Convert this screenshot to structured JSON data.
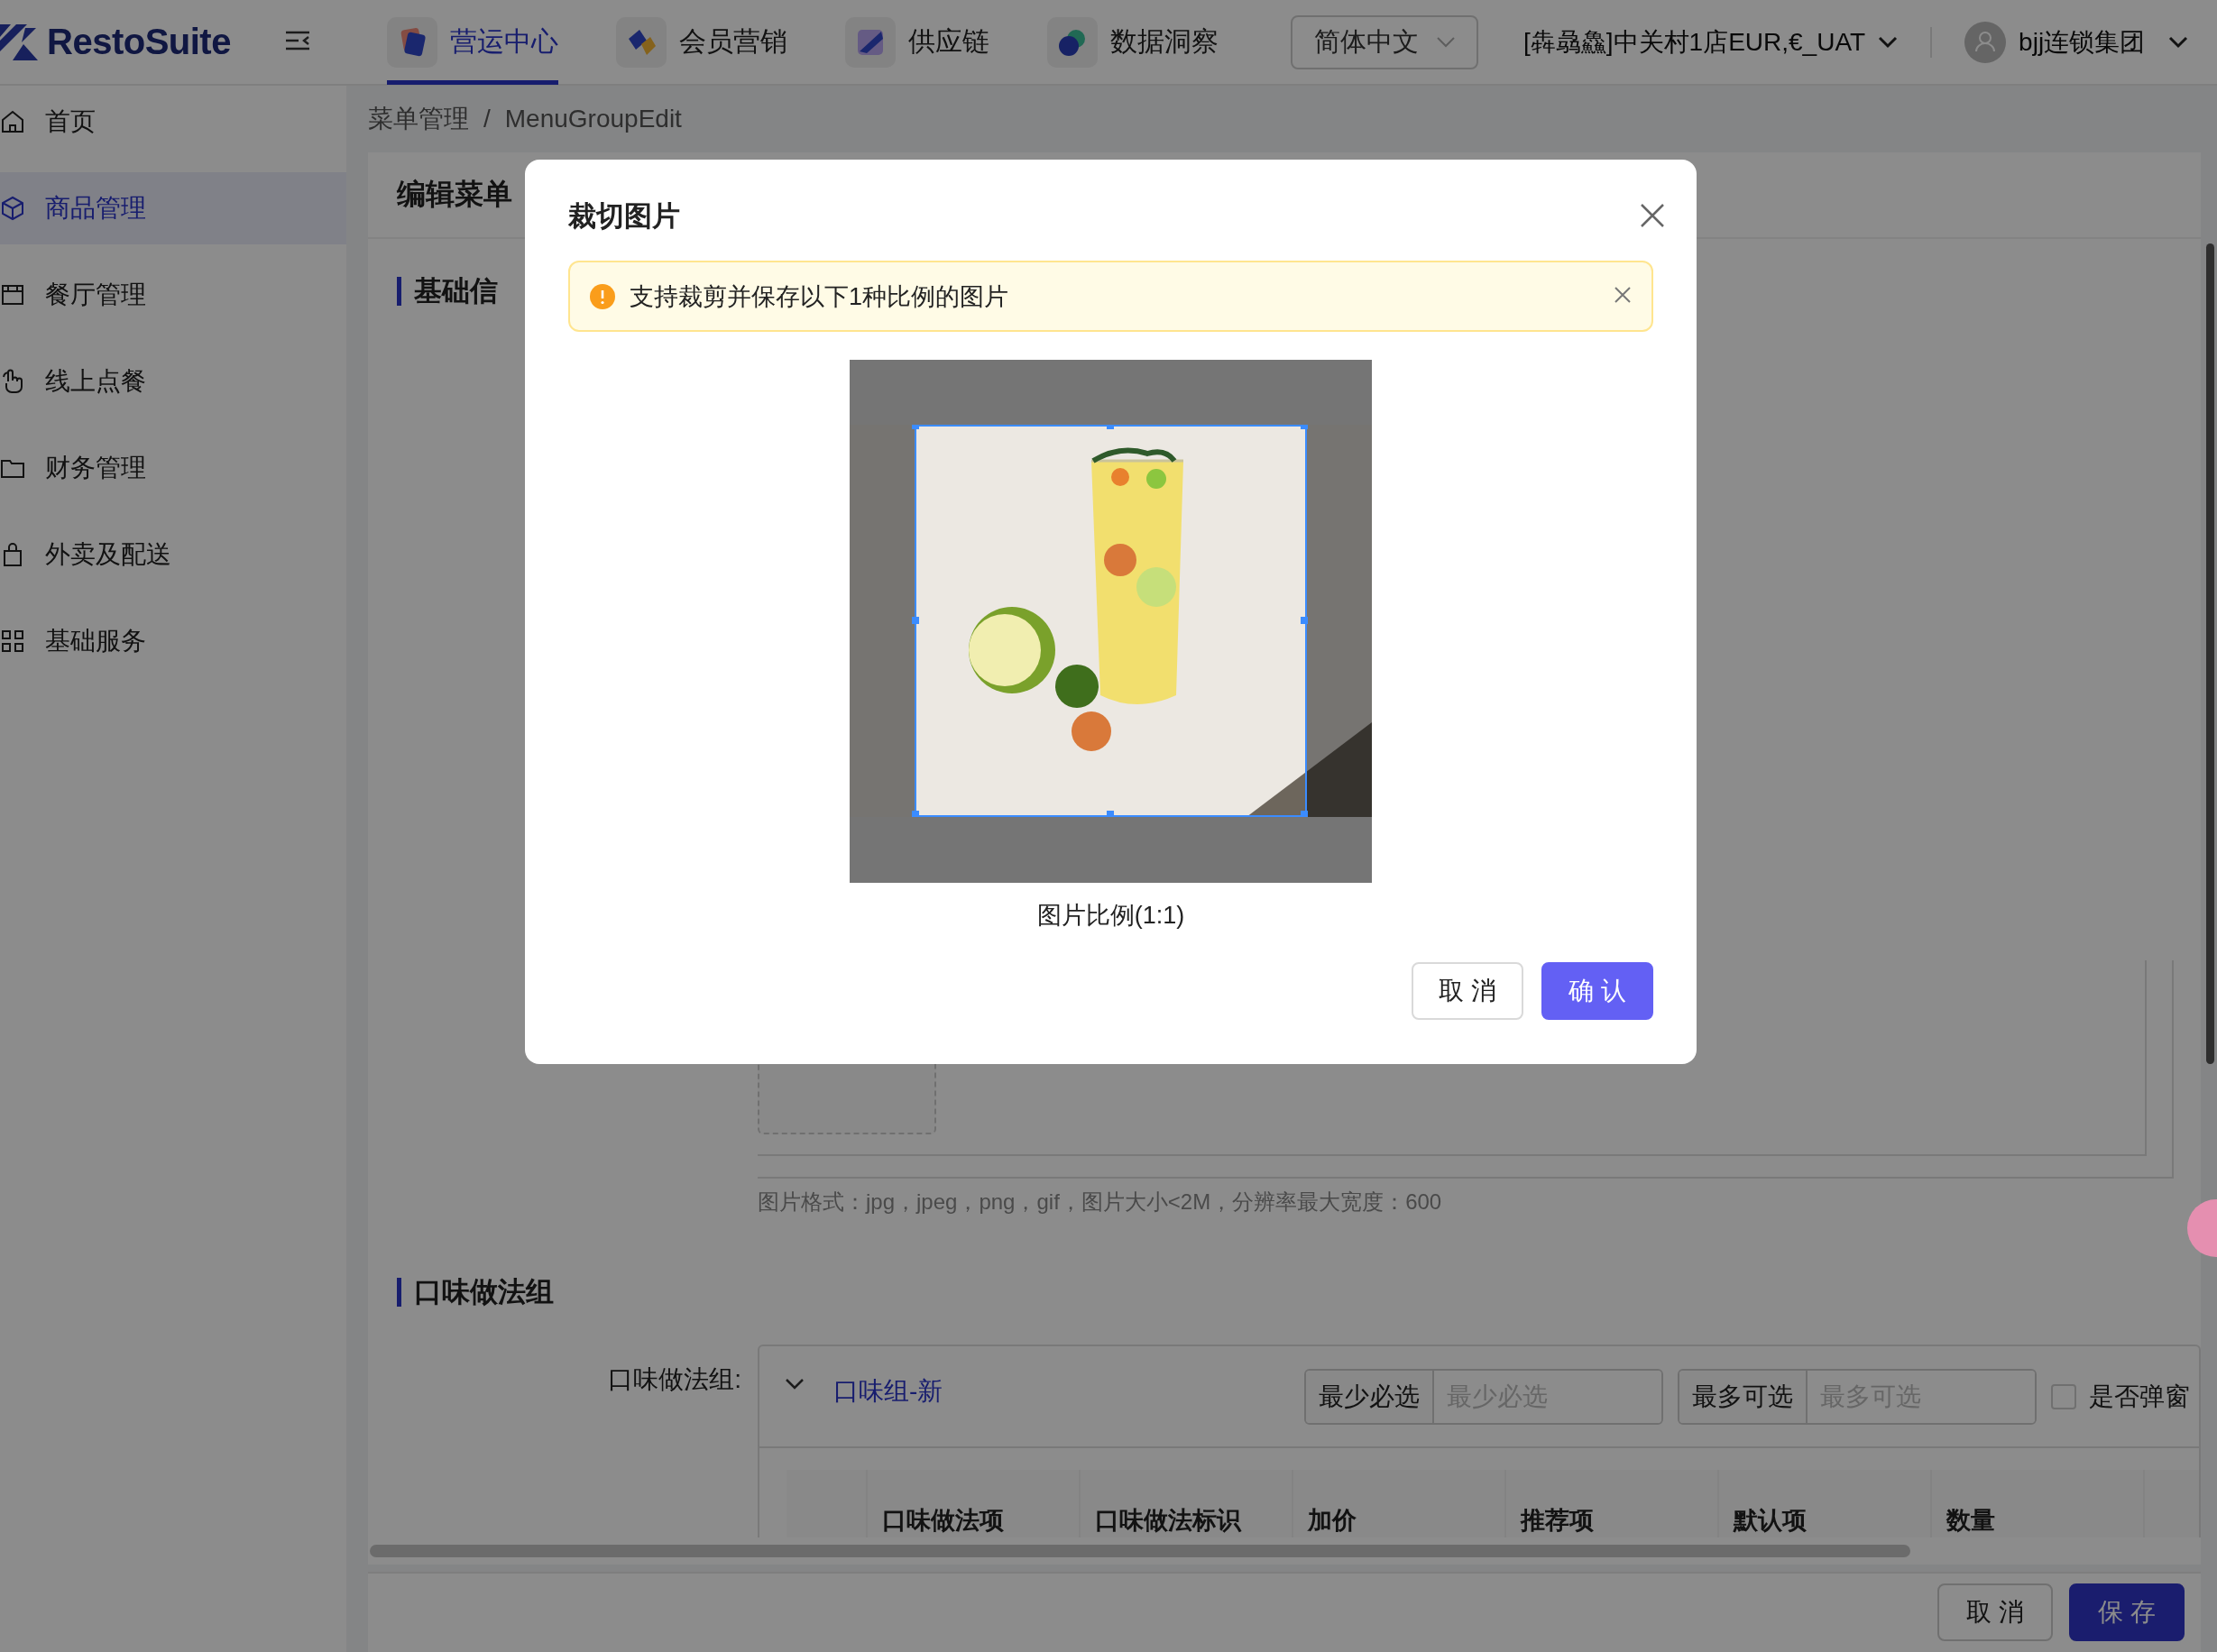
{
  "header": {
    "logo": "RestoSuite",
    "nav": [
      {
        "label": "营运中心",
        "selected": true
      },
      {
        "label": "会员营销",
        "selected": false
      },
      {
        "label": "供应链",
        "selected": false
      },
      {
        "label": "数据洞察",
        "selected": false
      }
    ],
    "language": "简体中文",
    "store": "[犇骉鱻]中关村1店EUR,€_UAT",
    "user": "bjj连锁集团"
  },
  "sidebar": {
    "items": [
      {
        "label": "首页",
        "selected": false
      },
      {
        "label": "商品管理",
        "selected": true
      },
      {
        "label": "餐厅管理",
        "selected": false
      },
      {
        "label": "线上点餐",
        "selected": false
      },
      {
        "label": "财务管理",
        "selected": false
      },
      {
        "label": "外卖及配送",
        "selected": false
      },
      {
        "label": "基础服务",
        "selected": false
      }
    ]
  },
  "breadcrumb": [
    "菜单管理",
    "MenuGroupEdit"
  ],
  "breadcrumb_separator": "/",
  "page": {
    "title": "编辑菜单",
    "section_1": "基础信",
    "upload_hint": "图片格式：jpg，jpeg，png，gif，图片大小<2M，分辨率最大宽度：600",
    "section_2": "口味做法组",
    "field_label": "口味做法组:",
    "group": {
      "name": "口味组-新",
      "expanded": true,
      "min": {
        "addon": "最少必选",
        "placeholder": "最少必选"
      },
      "max": {
        "addon": "最多可选",
        "placeholder": "最多可选"
      },
      "popup": {
        "label": "是否弹窗",
        "checked": false
      },
      "columns": [
        "口味做法项",
        "口味做法标识",
        "加价",
        "推荐项",
        "默认项",
        "数量"
      ]
    },
    "footer_buttons": [
      "取 消",
      "保 存"
    ]
  },
  "modal": {
    "title": "裁切图片",
    "alert": "支持裁剪并保存以下1种比例的图片",
    "ratio": "图片比例(1:1)",
    "cancel": "取 消",
    "confirm": "确 认"
  }
}
